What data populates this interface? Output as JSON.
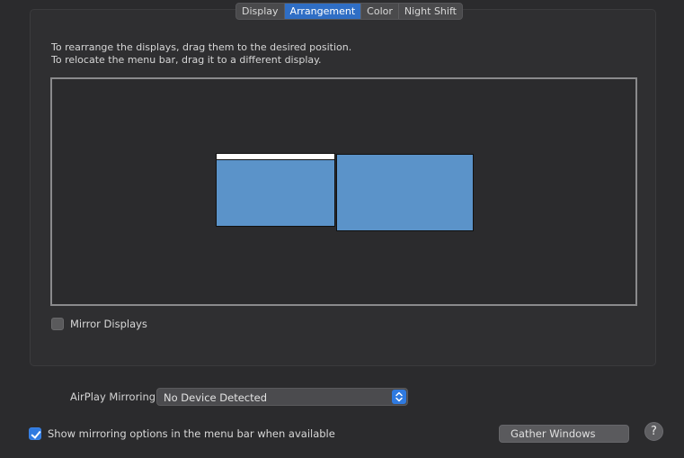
{
  "tabs": [
    {
      "label": "Display",
      "active": false
    },
    {
      "label": "Arrangement",
      "active": true
    },
    {
      "label": "Color",
      "active": false
    },
    {
      "label": "Night Shift",
      "active": false
    }
  ],
  "instructions": {
    "line1": "To rearrange the displays, drag them to the desired position.",
    "line2": "To relocate the menu bar, drag it to a different display."
  },
  "mirror_displays": {
    "label": "Mirror Displays",
    "checked": false
  },
  "airplay": {
    "label": "AirPlay Mirroring:",
    "value": "No Device Detected",
    "icon": "up-down-chevron-icon"
  },
  "show_mirroring": {
    "label": "Show mirroring options in the menu bar when available",
    "checked": true
  },
  "gather_windows_label": "Gather Windows",
  "help_label": "?",
  "colors": {
    "accent": "#2f7ae0",
    "display_fill": "#5b93c9",
    "menubar": "#ffffff",
    "background": "#2b2b2d"
  }
}
